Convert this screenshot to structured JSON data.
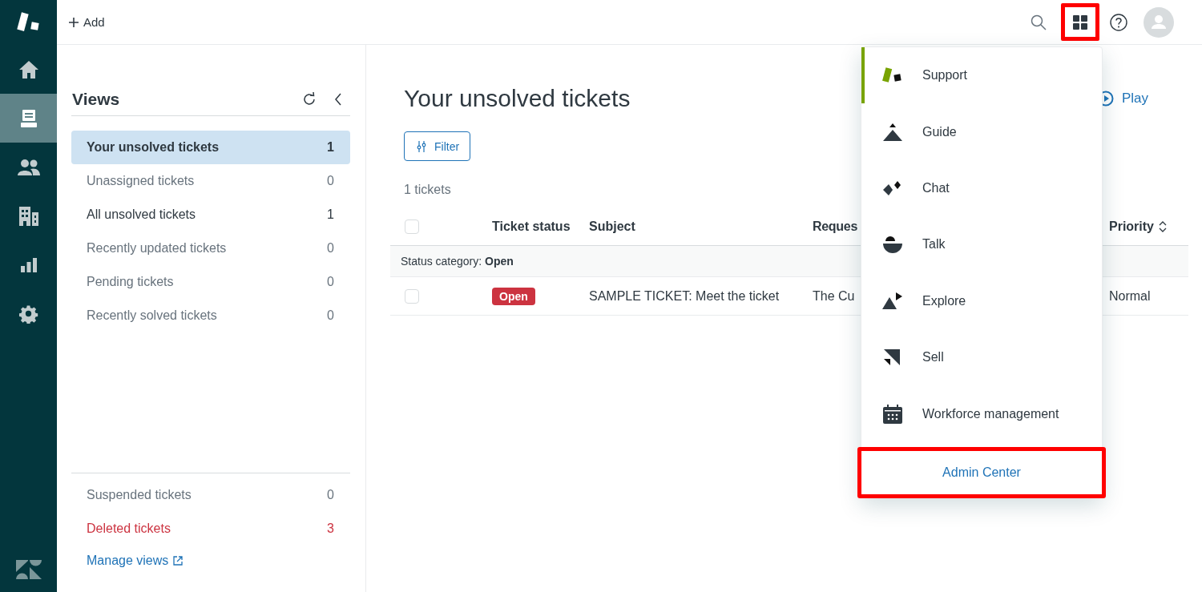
{
  "nav": {
    "items": [
      {
        "kind": "home",
        "selected": false
      },
      {
        "kind": "tickets",
        "selected": true
      },
      {
        "kind": "users",
        "selected": false
      },
      {
        "kind": "organizations",
        "selected": false
      },
      {
        "kind": "reports",
        "selected": false
      },
      {
        "kind": "settings",
        "selected": false
      }
    ]
  },
  "top_bar": {
    "add_label": "Add",
    "actions": [
      {
        "kind": "search",
        "highlighted": false
      },
      {
        "kind": "apps",
        "highlighted": true
      },
      {
        "kind": "help",
        "highlighted": false
      },
      {
        "kind": "avatar",
        "highlighted": false
      }
    ]
  },
  "views": {
    "title": "Views",
    "items": [
      {
        "label": "Your unsolved tickets",
        "count": "1",
        "selected": true,
        "muted": false
      },
      {
        "label": "Unassigned tickets",
        "count": "0",
        "selected": false,
        "muted": true
      },
      {
        "label": "All unsolved tickets",
        "count": "1",
        "selected": false,
        "muted": false
      },
      {
        "label": "Recently updated tickets",
        "count": "0",
        "selected": false,
        "muted": true
      },
      {
        "label": "Pending tickets",
        "count": "0",
        "selected": false,
        "muted": true
      },
      {
        "label": "Recently solved tickets",
        "count": "0",
        "selected": false,
        "muted": true
      }
    ],
    "footer_items": [
      {
        "label": "Suspended tickets",
        "count": "0",
        "kind": "normal"
      },
      {
        "label": "Deleted tickets",
        "count": "3",
        "kind": "danger"
      }
    ],
    "manage_link": "Manage views"
  },
  "main": {
    "title": "Your unsolved tickets",
    "play_label": "Play",
    "filter_label": "Filter",
    "count_text": "1 tickets",
    "select_all_checked": false,
    "columns": [
      {
        "label": "Ticket status"
      },
      {
        "label": "Subject"
      },
      {
        "label": "Reques"
      },
      {
        "label": "Priority",
        "sortable": true
      }
    ],
    "groups": [
      {
        "label": "Status category: **Open**",
        "rows": [
          {
            "checked": false,
            "status": "Open",
            "subject": "SAMPLE TICKET: Meet the ticket",
            "requester": "The Cu",
            "priority": "Normal"
          }
        ]
      }
    ]
  },
  "product_menu": {
    "items": [
      {
        "kind": "support",
        "label": "Support",
        "selected": true
      },
      {
        "kind": "guide",
        "label": "Guide",
        "selected": false
      },
      {
        "kind": "chat",
        "label": "Chat",
        "selected": false
      },
      {
        "kind": "talk",
        "label": "Talk",
        "selected": false
      },
      {
        "kind": "explore",
        "label": "Explore",
        "selected": false
      },
      {
        "kind": "sell",
        "label": "Sell",
        "selected": false
      },
      {
        "kind": "workforce",
        "label": "Workforce management",
        "selected": false
      }
    ],
    "admin": {
      "label": "Admin Center",
      "highlighted": true
    }
  }
}
